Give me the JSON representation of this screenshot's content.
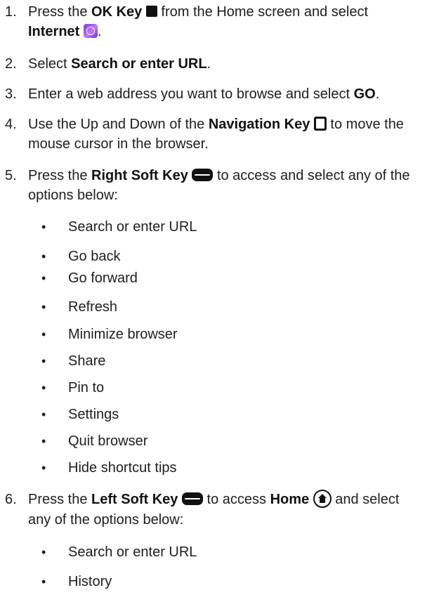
{
  "steps": [
    {
      "num": "1.",
      "a": "Press the ",
      "b1": "OK Key",
      "c": " from the Home screen and select",
      "d": "Internet",
      "e": "."
    },
    {
      "num": "2.",
      "a": "Select ",
      "b1": "Search or enter URL",
      "c": "."
    },
    {
      "num": "3.",
      "a": "Enter a web address you want to browse and select ",
      "b1": "GO",
      "c": "."
    },
    {
      "num": "4.",
      "a": "Use the Up and Down of the ",
      "b1": "Navigation Key",
      "c": " to move the",
      "d": "mouse cursor in the browser."
    },
    {
      "num": "5.",
      "a": "Press the ",
      "b1": "Right Soft Key",
      "c": " to access and select any of the",
      "d": "options below:",
      "bullets": [
        "Search or enter URL",
        "Go back",
        "Go forward",
        "Refresh",
        "Minimize browser",
        "Share",
        "Pin to",
        "Settings",
        "Quit browser",
        "Hide shortcut tips"
      ]
    },
    {
      "num": "6.",
      "a": "Press the ",
      "b1": "Left Soft Key",
      "c": " to access ",
      "b2": "Home",
      "c2": " and select",
      "d": "any of the options below:",
      "bullets": [
        "Search or enter URL",
        "History"
      ]
    }
  ],
  "bullet_glyph": "•",
  "icons": {
    "ok_key": "ok-key-icon",
    "internet": "internet-app-icon",
    "navigation_key": "navigation-key-icon",
    "right_soft_key": "right-soft-key-icon",
    "left_soft_key": "left-soft-key-icon",
    "home": "home-icon"
  }
}
